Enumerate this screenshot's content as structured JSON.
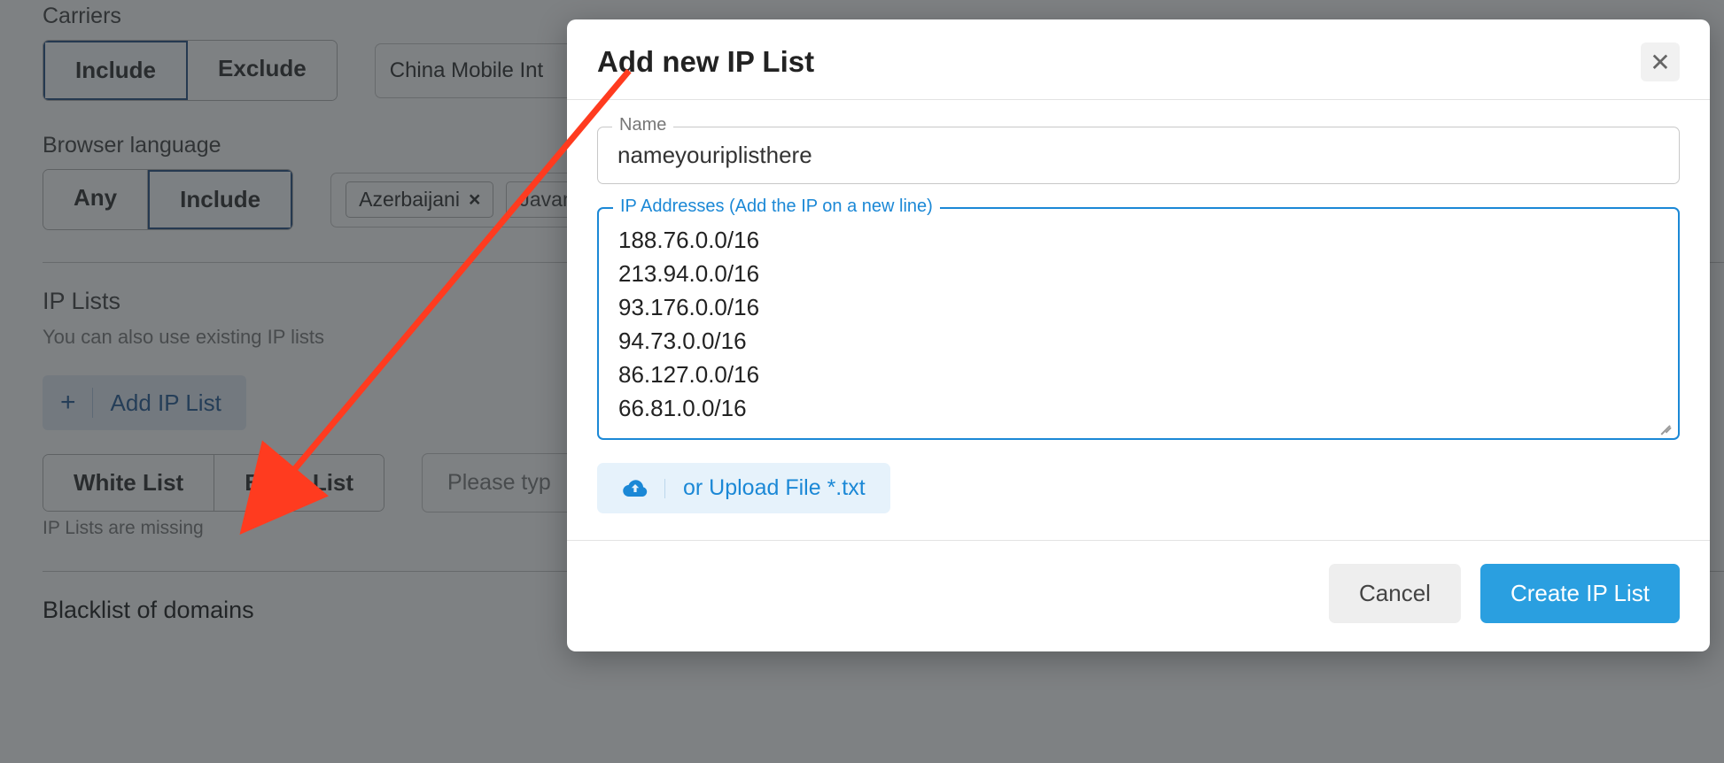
{
  "background": {
    "carriers": {
      "title": "Carriers",
      "include": "Include",
      "exclude": "Exclude",
      "selected_value": "China Mobile Int"
    },
    "language": {
      "title": "Browser language",
      "any": "Any",
      "include": "Include",
      "tags": [
        {
          "label": "Azerbaijani",
          "close": "×"
        },
        {
          "label": "Javan",
          "close": "×"
        }
      ]
    },
    "ip": {
      "title": "IP Lists",
      "subtitle": "You can also use existing IP lists",
      "add_button": "Add IP List",
      "white_list": "White List",
      "black_list": "Black List",
      "placeholder": "Please typ",
      "missing_msg": "IP Lists are missing"
    },
    "blacklist_domains": {
      "title": "Blacklist of domains"
    }
  },
  "modal": {
    "title": "Add new IP List",
    "name_field": {
      "label": "Name",
      "value": "nameyouriplisthere"
    },
    "ip_field": {
      "label": "IP Addresses (Add the IP on a new line)",
      "value": "188.76.0.0/16\n213.94.0.0/16\n93.176.0.0/16\n94.73.0.0/16\n86.127.0.0/16\n66.81.0.0/16"
    },
    "upload_button": "or Upload File *.txt",
    "cancel": "Cancel",
    "create": "Create IP List"
  }
}
